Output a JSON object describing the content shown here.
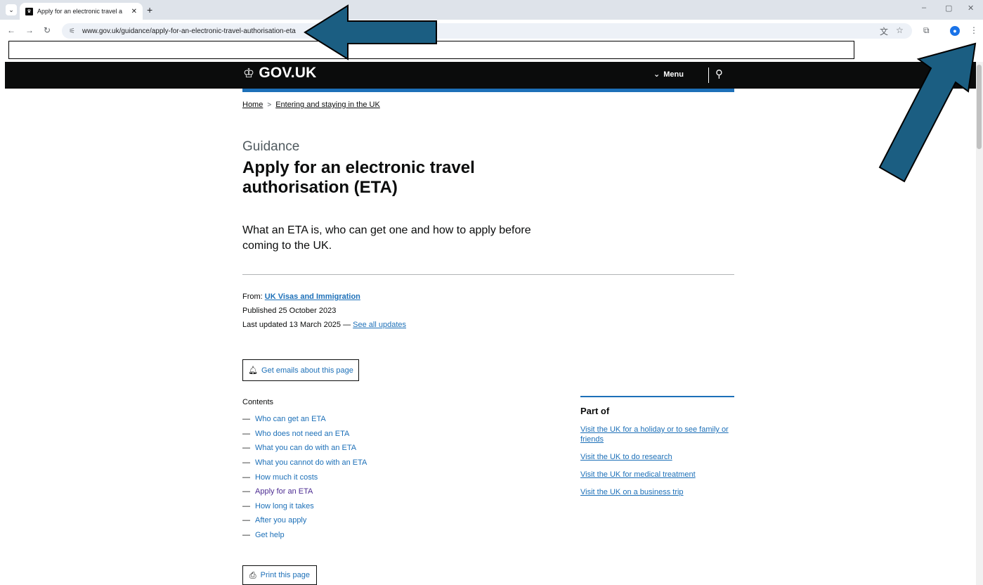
{
  "browser": {
    "tab_title": "Apply for an electronic travel a",
    "url": "www.gov.uk/guidance/apply-for-an-electronic-travel-authorisation-eta",
    "new_tab_label": "+"
  },
  "header": {
    "logo_text": "GOV.UK",
    "menu_label": "Menu"
  },
  "breadcrumb": [
    {
      "label": "Home"
    },
    {
      "label": "Entering and staying in the UK"
    }
  ],
  "page": {
    "caption": "Guidance",
    "title": "Apply for an electronic travel authorisation (ETA)",
    "summary": "What an ETA is, who can get one and how to apply before coming to the UK."
  },
  "metadata": {
    "from_label": "From:",
    "from_org": "UK Visas and Immigration",
    "published": "Published 25 October 2023",
    "updated": "Last updated 13 March 2025 —",
    "see_updates": "See all updates"
  },
  "buttons": {
    "get_emails": "Get emails about this page",
    "print": "Print this page"
  },
  "contents": {
    "title": "Contents",
    "items": [
      {
        "label": "Who can get an ETA"
      },
      {
        "label": "Who does not need an ETA"
      },
      {
        "label": "What you can do with an ETA"
      },
      {
        "label": "What you cannot do with an ETA"
      },
      {
        "label": "How much it costs"
      },
      {
        "label": "Apply for an ETA",
        "visited": true
      },
      {
        "label": "How long it takes"
      },
      {
        "label": "After you apply"
      },
      {
        "label": "Get help"
      }
    ]
  },
  "part_of": {
    "title": "Part of",
    "links": [
      "Visit the UK for a holiday or to see family or friends",
      "Visit the UK to do research",
      "Visit the UK for medical treatment",
      "Visit the UK on a business trip"
    ]
  },
  "colors": {
    "govuk_black": "#0b0c0c",
    "govuk_blue": "#1d70b8",
    "visited_link": "#4c2c92",
    "annotation_arrow": "#1b5e82"
  }
}
